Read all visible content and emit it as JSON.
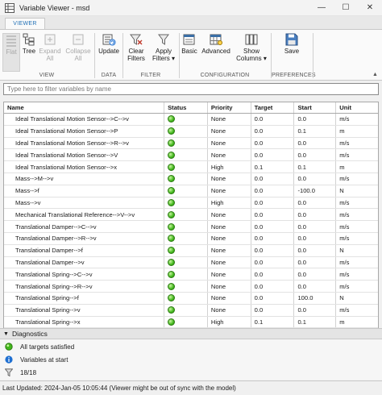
{
  "window": {
    "title": "Variable Viewer - msd",
    "minimize": "—",
    "maximize": "☐",
    "close": "✕"
  },
  "tabs": [
    {
      "label": "VIEWER",
      "selected": true
    }
  ],
  "toolstrip": {
    "view": {
      "label": "VIEW",
      "flat": "Flat",
      "tree": "Tree",
      "expand": [
        "Expand",
        "All"
      ],
      "collapse": [
        "Collapse",
        "All"
      ]
    },
    "data": {
      "label": "DATA",
      "update": "Update"
    },
    "filter": {
      "label": "FILTER",
      "clear": [
        "Clear",
        "Filters"
      ],
      "apply": [
        "Apply",
        "Filters ▾"
      ]
    },
    "configuration": {
      "label": "CONFIGURATION",
      "basic": "Basic",
      "advanced": "Advanced",
      "show_columns": [
        "Show",
        "Columns ▾"
      ]
    },
    "preferences": {
      "label": "PREFERENCES",
      "save": "Save"
    },
    "collapse_toolstrip": "▲"
  },
  "filter_input": {
    "placeholder": "Type here to filter variables by name",
    "value": ""
  },
  "table": {
    "headers": {
      "name": "Name",
      "status": "Status",
      "priority": "Priority",
      "target": "Target",
      "start": "Start",
      "unit": "Unit"
    },
    "rows": [
      {
        "name": "Ideal Translational Motion Sensor-->C-->v",
        "status": "ok",
        "priority": "None",
        "target": "0.0",
        "start": "0.0",
        "unit": "m/s"
      },
      {
        "name": "Ideal Translational Motion Sensor-->P",
        "status": "ok",
        "priority": "None",
        "target": "0.0",
        "start": "0.1",
        "unit": "m"
      },
      {
        "name": "Ideal Translational Motion Sensor-->R-->v",
        "status": "ok",
        "priority": "None",
        "target": "0.0",
        "start": "0.0",
        "unit": "m/s"
      },
      {
        "name": "Ideal Translational Motion Sensor-->V",
        "status": "ok",
        "priority": "None",
        "target": "0.0",
        "start": "0.0",
        "unit": "m/s"
      },
      {
        "name": "Ideal Translational Motion Sensor-->x",
        "status": "ok",
        "priority": "High",
        "target": "0.1",
        "start": "0.1",
        "unit": "m"
      },
      {
        "name": "Mass-->M-->v",
        "status": "ok",
        "priority": "None",
        "target": "0.0",
        "start": "0.0",
        "unit": "m/s"
      },
      {
        "name": "Mass-->f",
        "status": "ok",
        "priority": "None",
        "target": "0.0",
        "start": "-100.0",
        "unit": "N"
      },
      {
        "name": "Mass-->v",
        "status": "ok",
        "priority": "High",
        "target": "0.0",
        "start": "0.0",
        "unit": "m/s"
      },
      {
        "name": "Mechanical Translational Reference-->V-->v",
        "status": "ok",
        "priority": "None",
        "target": "0.0",
        "start": "0.0",
        "unit": "m/s"
      },
      {
        "name": "Translational Damper-->C-->v",
        "status": "ok",
        "priority": "None",
        "target": "0.0",
        "start": "0.0",
        "unit": "m/s"
      },
      {
        "name": "Translational Damper-->R-->v",
        "status": "ok",
        "priority": "None",
        "target": "0.0",
        "start": "0.0",
        "unit": "m/s"
      },
      {
        "name": "Translational Damper-->f",
        "status": "ok",
        "priority": "None",
        "target": "0.0",
        "start": "0.0",
        "unit": "N"
      },
      {
        "name": "Translational Damper-->v",
        "status": "ok",
        "priority": "None",
        "target": "0.0",
        "start": "0.0",
        "unit": "m/s"
      },
      {
        "name": "Translational Spring-->C-->v",
        "status": "ok",
        "priority": "None",
        "target": "0.0",
        "start": "0.0",
        "unit": "m/s"
      },
      {
        "name": "Translational Spring-->R-->v",
        "status": "ok",
        "priority": "None",
        "target": "0.0",
        "start": "0.0",
        "unit": "m/s"
      },
      {
        "name": "Translational Spring-->f",
        "status": "ok",
        "priority": "None",
        "target": "0.0",
        "start": "100.0",
        "unit": "N"
      },
      {
        "name": "Translational Spring-->v",
        "status": "ok",
        "priority": "None",
        "target": "0.0",
        "start": "0.0",
        "unit": "m/s"
      },
      {
        "name": "Translational Spring-->x",
        "status": "ok",
        "priority": "High",
        "target": "0.1",
        "start": "0.1",
        "unit": "m"
      }
    ]
  },
  "diagnostics": {
    "title": "Diagnostics",
    "items": [
      {
        "icon": "green-circle-icon",
        "text": "All targets satisfied"
      },
      {
        "icon": "info-icon",
        "text": "Variables at start"
      },
      {
        "icon": "filter-icon",
        "text": "18/18"
      }
    ]
  },
  "status_bar": {
    "text": "Last Updated: 2024-Jan-05 10:05:44 (Viewer might be out of sync with the model)"
  },
  "colors": {
    "accent": "#1f6fb5",
    "status_ok": "#42b81c",
    "info": "#1e6fd1"
  }
}
